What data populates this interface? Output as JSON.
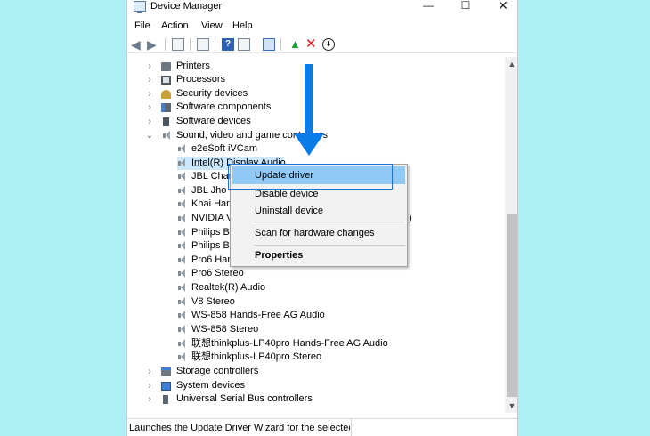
{
  "window": {
    "title": "Device Manager",
    "controls": {
      "minimize": "—",
      "maximize": "☐",
      "close": "✕"
    }
  },
  "menubar": [
    "File",
    "Action",
    "View",
    "Help"
  ],
  "toolbar": {
    "icons": [
      "back-arrow-icon",
      "forward-arrow-icon",
      "show-hide-tree-icon",
      "properties-icon",
      "help-icon",
      "action-pane-icon",
      "monitor-scan-icon",
      "update-driver-icon",
      "uninstall-x-icon",
      "download-icon"
    ]
  },
  "tree": {
    "categories_top": [
      {
        "label": "Printers",
        "icon": "printer-icon"
      },
      {
        "label": "Processors",
        "icon": "processor-icon"
      },
      {
        "label": "Security devices",
        "icon": "security-key-icon"
      },
      {
        "label": "Software components",
        "icon": "software-component-icon"
      },
      {
        "label": "Software devices",
        "icon": "software-device-icon"
      }
    ],
    "expanded_category": {
      "label": "Sound, video and game controllers",
      "icon": "speaker-icon"
    },
    "children": [
      "e2eSoft iVCam",
      "Intel(R) Display Audio",
      "JBL Charg",
      "JBL Jho S",
      "Khai Han",
      "NVIDIA V",
      "Philips BT",
      "Philips BT",
      "Pro6 Han",
      "Pro6 Stereo",
      "Realtek(R) Audio",
      "V8 Stereo",
      "WS-858 Hands-Free AG Audio",
      "WS-858 Stereo",
      "联想thinkplus-LP40pro Hands-Free AG Audio",
      "联想thinkplus-LP40pro Stereo"
    ],
    "partial_right_glyph": ")",
    "categories_bottom": [
      {
        "label": "Storage controllers",
        "icon": "storage-controller-icon"
      },
      {
        "label": "System devices",
        "icon": "system-device-icon"
      },
      {
        "label": "Universal Serial Bus controllers",
        "icon": "usb-icon"
      }
    ]
  },
  "context_menu": {
    "items": [
      "Update driver",
      "Disable device",
      "Uninstall device",
      "Scan for hardware changes",
      "Properties"
    ],
    "highlighted": "Update driver"
  },
  "statusbar": {
    "text": "Launches the Update Driver Wizard for the selected de"
  },
  "colors": {
    "background": "#aeeef5",
    "annotation_arrow": "#0b7be8",
    "highlight_box": "#1a73d8",
    "menu_highlight": "#91c9f7",
    "selected_row": "#cce8ff"
  }
}
